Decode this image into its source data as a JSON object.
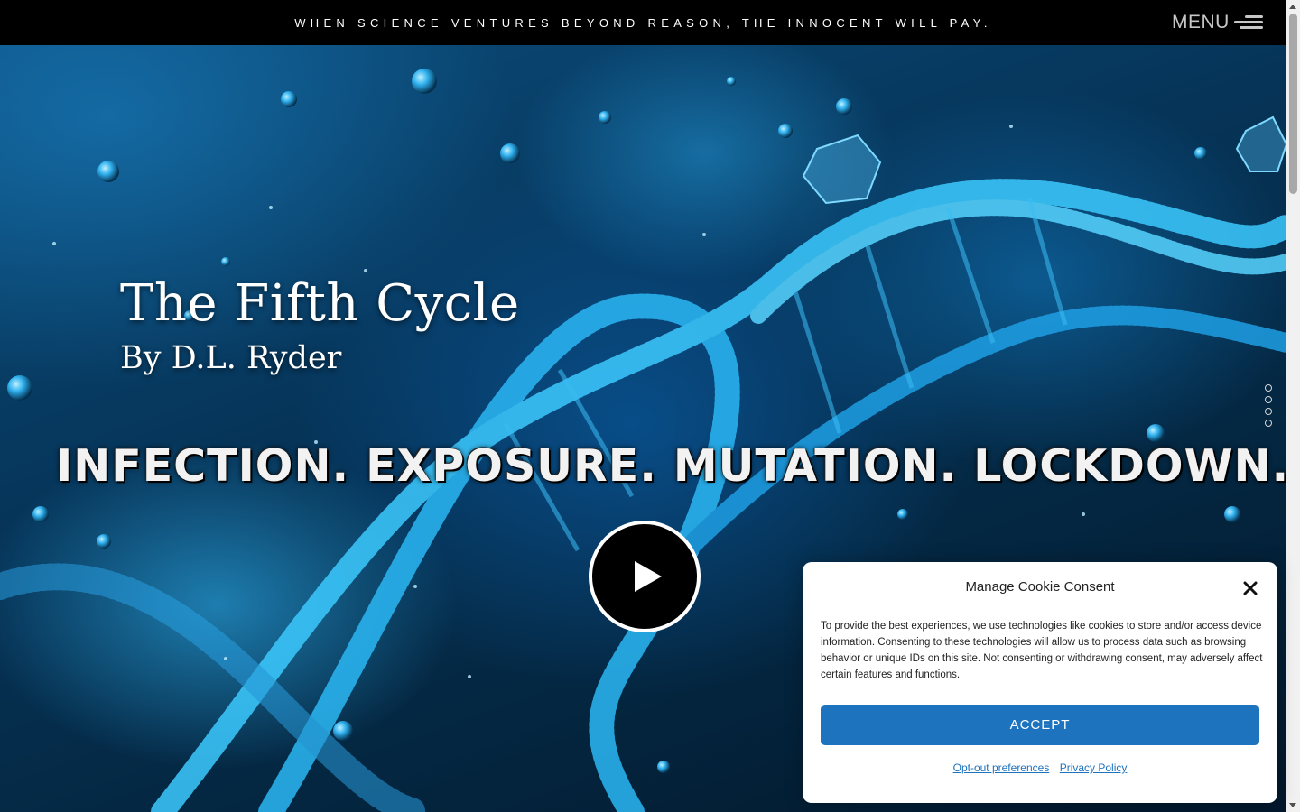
{
  "header": {
    "tagline": "WHEN SCIENCE VENTURES BEYOND REASON, THE INNOCENT WILL PAY.",
    "menu_label": "MENU",
    "menu_icon": "hamburger-icon"
  },
  "hero": {
    "title": "The Fifth Cycle",
    "author": "By D.L. Ryder",
    "slogan": "INFECTION. EXPOSURE. MUTATION. LOCKDOWN.",
    "play_icon": "play-icon",
    "slide_count": 4
  },
  "cookie": {
    "title": "Manage Cookie Consent",
    "body": "To provide the best experiences, we use technologies like cookies to store and/or access device information. Consenting to these technologies will allow us to process data such as browsing behavior or unique IDs on this site. Not consenting or withdrawing consent, may adversely affect certain features and functions.",
    "accept_label": "ACCEPT",
    "optout_label": "Opt-out preferences",
    "privacy_label": "Privacy Policy",
    "close_icon": "close-icon",
    "accent_color": "#1e73be"
  }
}
